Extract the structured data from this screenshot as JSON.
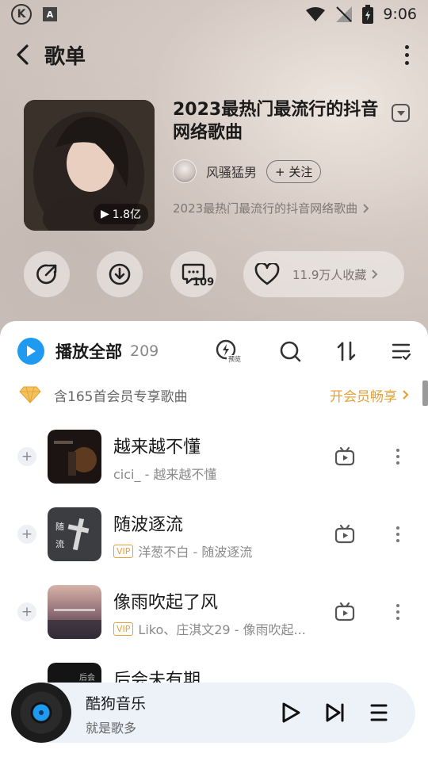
{
  "status": {
    "time": "9:06",
    "k_logo": "K",
    "a_logo": "A"
  },
  "header": {
    "title": "歌单"
  },
  "playlist": {
    "title": "2023最热门最流行的抖音网络歌曲",
    "play_count": "1.8亿",
    "creator": "风骚猛男",
    "follow_label": "+ 关注",
    "description": "2023最热门最流行的抖音网络歌曲"
  },
  "actions": {
    "comment_count": "109",
    "collect_label": "11.9万人收藏"
  },
  "list_header": {
    "play_all_label": "播放全部",
    "count": "209"
  },
  "vip_bar": {
    "text": "含165首会员专享歌曲",
    "cta": "开会员畅享"
  },
  "songs": [
    {
      "title": "越来越不懂",
      "subtitle": "cici_ - 越来越不懂",
      "vip": false
    },
    {
      "title": "随波逐流",
      "subtitle": "洋葱不白 - 随波逐流",
      "vip": true
    },
    {
      "title": "像雨吹起了风",
      "subtitle": "Liko、庄淇文29 - 像雨吹起...",
      "vip": true
    },
    {
      "title": "后会未有期",
      "subtitle": "",
      "vip": false
    }
  ],
  "vip_tag_label": "VIP",
  "player": {
    "title": "酷狗音乐",
    "subtitle": "就是歌多"
  },
  "colors": {
    "accent": "#1e9bf0",
    "vip_gold": "#e4a23a"
  }
}
